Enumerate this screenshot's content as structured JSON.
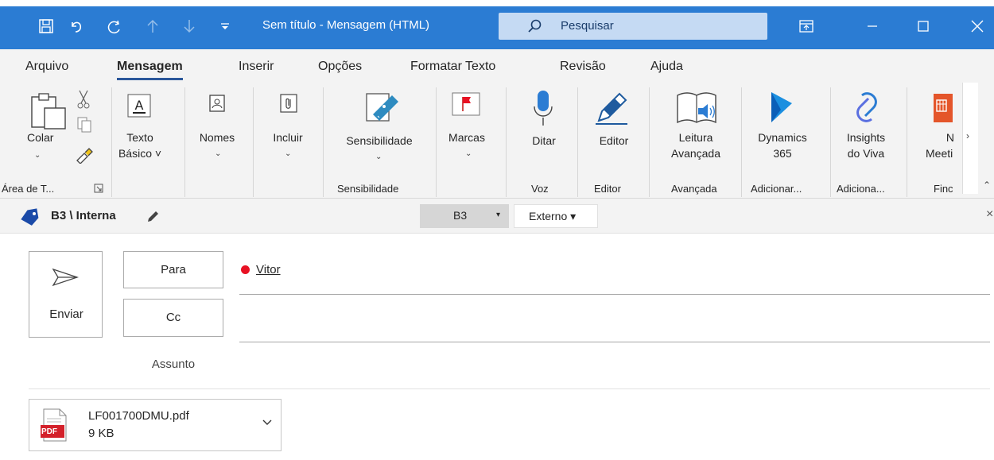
{
  "titlebar": {
    "title": "Sem título  -  Mensagem (HTML)",
    "search_placeholder": "Pesquisar",
    "qat_icons": [
      "save-icon",
      "undo-icon",
      "redo-icon",
      "up-arrow-icon",
      "down-arrow-icon",
      "customize-icon"
    ],
    "window_controls": [
      "ribbon-display-icon",
      "minimize-icon",
      "maximize-icon",
      "close-icon"
    ],
    "accent": "#2b7cd3"
  },
  "menu": {
    "tabs": [
      "Arquivo",
      "Mensagem",
      "Inserir",
      "Opções",
      "Formatar Texto",
      "Revisão",
      "Ajuda"
    ],
    "active": "Mensagem"
  },
  "ribbon": {
    "colar": "Colar",
    "texto_basico_1": "Texto",
    "texto_basico_2": "Básico ˅",
    "nomes": "Nomes",
    "incluir": "Incluir",
    "sensibilidade": "Sensibilidade",
    "marcas": "Marcas",
    "ditar": "Ditar",
    "editor": "Editor",
    "leitura_1": "Leitura",
    "leitura_2": "Avançada",
    "dynamics_1": "Dynamics",
    "dynamics_2": "365",
    "insights_1": "Insights",
    "insights_2": "do Viva",
    "meeting_1": "N",
    "meeting_2": "Meeti",
    "groups": {
      "area_transferencia": "Área de T...",
      "sensibilidade": "Sensibilidade",
      "voz": "Voz",
      "editor": "Editor",
      "avancada": "Avançada",
      "adicionar1": "Adicionar...",
      "adicionar2": "Adiciona...",
      "find": "Finc"
    }
  },
  "infobar": {
    "label": "B3 \\ Interna",
    "dropdown1": "B3",
    "dropdown2": "Externo ▾",
    "close": "×"
  },
  "compose": {
    "send": "Enviar",
    "to": "Para",
    "cc": "Cc",
    "subject": "Assunto",
    "recipient": "Vitor",
    "recipient_status_color": "#e81123"
  },
  "attachment": {
    "name": "LF001700DMU.pdf",
    "size": "9 KB",
    "badge": "PDF"
  }
}
